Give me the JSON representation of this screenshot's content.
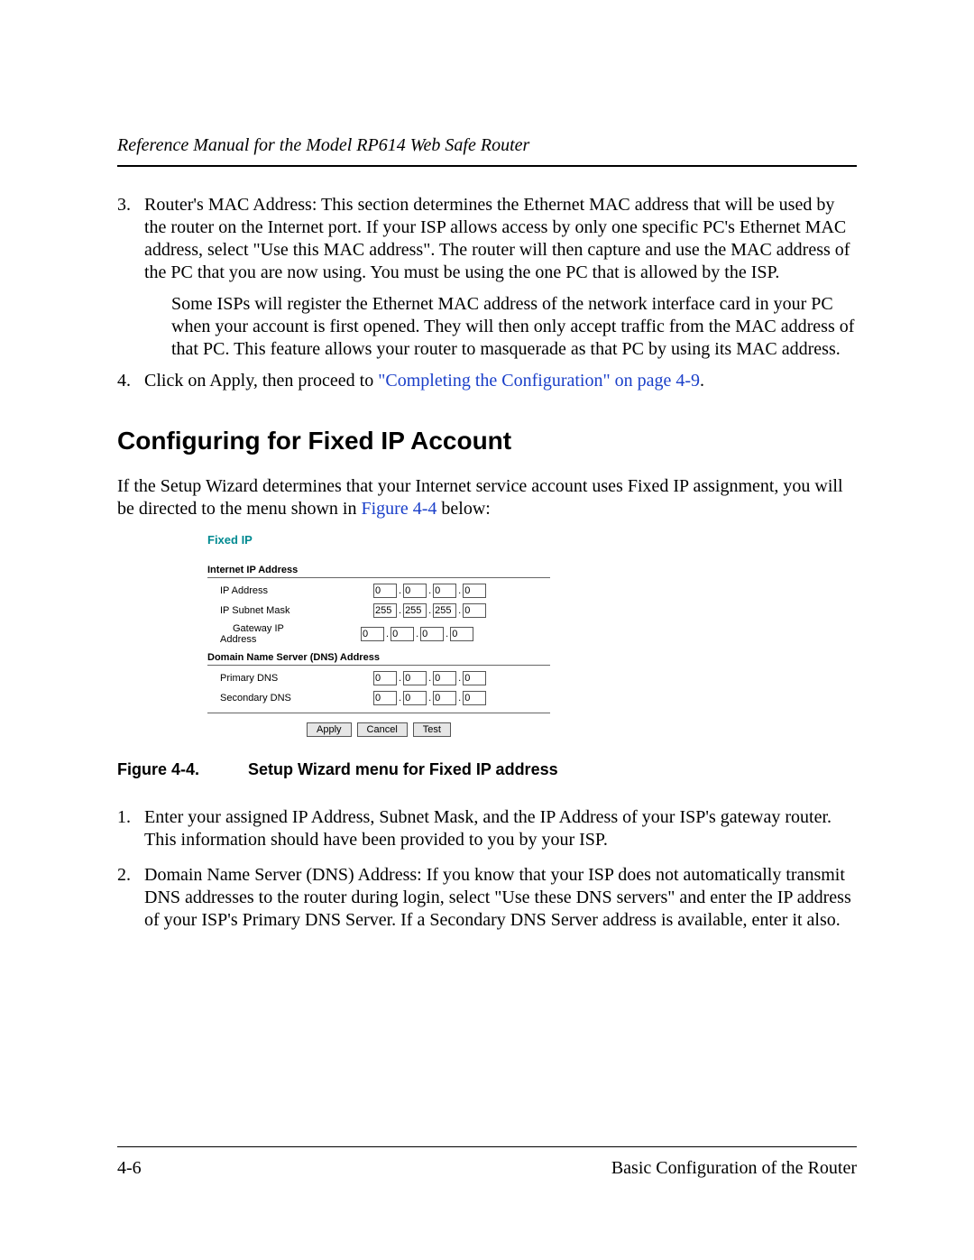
{
  "header": {
    "running_head": "Reference Manual for the Model RP614 Web Safe Router"
  },
  "list3": {
    "num": "3.",
    "text": "Router's MAC Address: This section determines the Ethernet MAC address that will be used by the router on the Internet port. If your ISP allows access by only one specific PC's Ethernet MAC address, select \"Use this MAC address\". The router will then capture and use the MAC address of the PC that you are now using. You must be using the one PC that is allowed by the ISP."
  },
  "indent3": "Some ISPs will register the Ethernet MAC address of the network interface card in your PC when your account is first opened. They will then only accept traffic from the MAC address of that PC. This feature allows your router to masquerade as that PC by using its MAC address.",
  "list4": {
    "num": "4.",
    "pre": "Click on Apply, then proceed to ",
    "link": "\"Completing the Configuration\" on page 4-9",
    "post": "."
  },
  "section_heading": "Configuring for Fixed IP Account",
  "intro": {
    "pre": "If the Setup Wizard determines that your Internet service account uses Fixed IP assignment, you will be directed to the menu shown in ",
    "link": "Figure 4-4",
    "post": " below:"
  },
  "figure": {
    "title": "Fixed IP",
    "sect1_label": "Internet IP Address",
    "rows1": [
      {
        "label": "IP Address",
        "octets": [
          "0",
          "0",
          "0",
          "0"
        ]
      },
      {
        "label": "IP Subnet Mask",
        "octets": [
          "255",
          "255",
          "255",
          "0"
        ]
      },
      {
        "label": "Gateway IP Address",
        "octets": [
          "0",
          "0",
          "0",
          "0"
        ],
        "two_line": true
      }
    ],
    "sect2_label": "Domain Name Server (DNS) Address",
    "rows2": [
      {
        "label": "Primary DNS",
        "octets": [
          "0",
          "0",
          "0",
          "0"
        ]
      },
      {
        "label": "Secondary DNS",
        "octets": [
          "0",
          "0",
          "0",
          "0"
        ]
      }
    ],
    "buttons": {
      "apply": "Apply",
      "cancel": "Cancel",
      "test": "Test"
    }
  },
  "caption": {
    "num": "Figure 4-4.",
    "text": "Setup Wizard menu for Fixed IP address"
  },
  "steps": [
    {
      "num": "1.",
      "text": "Enter your assigned IP Address, Subnet Mask, and the IP Address of your ISP's gateway router. This information should have been provided to you by your ISP."
    },
    {
      "num": "2.",
      "text": "Domain Name Server (DNS) Address: If you know that your ISP does not automatically transmit DNS addresses to the router during login, select \"Use these DNS servers\" and enter the IP address of your ISP's Primary DNS Server. If a Secondary DNS Server address is available, enter it also."
    }
  ],
  "footer": {
    "left": "4-6",
    "right": "Basic Configuration of the Router"
  }
}
